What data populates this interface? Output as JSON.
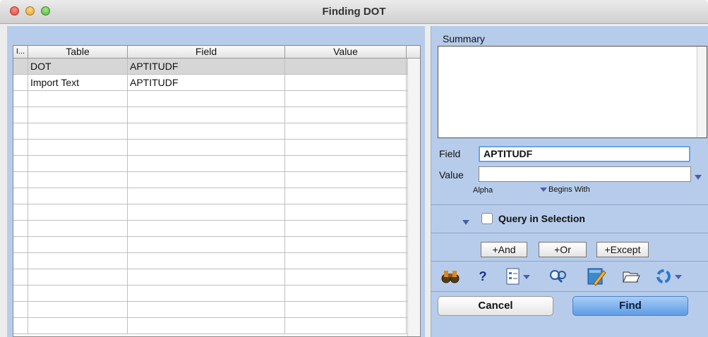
{
  "window": {
    "title": "Finding DOT"
  },
  "table": {
    "columns": [
      "I...",
      "Table",
      "Field",
      "Value"
    ],
    "rows": [
      {
        "table": "DOT",
        "field": "APTITUDF",
        "value": "",
        "selected": true
      },
      {
        "table": "Import Text",
        "field": "APTITUDF",
        "value": "",
        "selected": false
      }
    ]
  },
  "summary": {
    "label": "Summary",
    "text": ""
  },
  "query": {
    "field_label": "Field",
    "field_value": "APTITUDF",
    "value_label": "Value",
    "value_value": "",
    "type_label": "Alpha",
    "operator_label": "Begins With",
    "query_in_selection_label": "Query in Selection",
    "query_in_selection_checked": false
  },
  "logic_buttons": {
    "and": "+And",
    "or": "+Or",
    "except": "+Except"
  },
  "toolbar_icons": [
    "binoculars-icon",
    "help-icon",
    "query-file-icon",
    "search-magnifier-icon",
    "edit-notebook-icon",
    "open-folder-icon",
    "refresh-icon"
  ],
  "actions": {
    "cancel": "Cancel",
    "find": "Find"
  },
  "colors": {
    "pane_background": "#b7ccea",
    "find_button": "#5d9ce6",
    "field_focus_ring": "#6ba2e6"
  }
}
